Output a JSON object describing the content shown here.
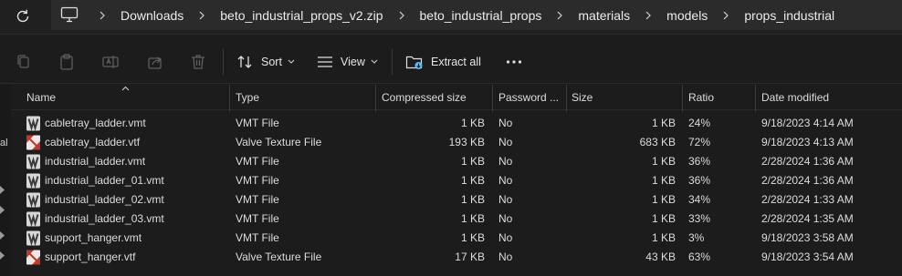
{
  "breadcrumbs": [
    "Downloads",
    "beto_industrial_props_v2.zip",
    "beto_industrial_props",
    "materials",
    "models",
    "props_industrial"
  ],
  "toolbar": {
    "sort_label": "Sort",
    "view_label": "View",
    "extract_label": "Extract all"
  },
  "left_pane_fragment": "al",
  "columns": {
    "name": "Name",
    "type": "Type",
    "compressed_size": "Compressed size",
    "password": "Password ...",
    "size": "Size",
    "ratio": "Ratio",
    "date_modified": "Date modified"
  },
  "files": [
    {
      "name": "cabletray_ladder.vmt",
      "icon": "vmt-file-icon",
      "type": "VMT File",
      "compressed": "1 KB",
      "password": "No",
      "size": "1 KB",
      "ratio": "24%",
      "date": "9/18/2023 4:14 AM"
    },
    {
      "name": "cabletray_ladder.vtf",
      "icon": "vtf-file-icon",
      "type": "Valve Texture File",
      "compressed": "193 KB",
      "password": "No",
      "size": "683 KB",
      "ratio": "72%",
      "date": "9/18/2023 4:13 AM"
    },
    {
      "name": "industrial_ladder.vmt",
      "icon": "vmt-file-icon",
      "type": "VMT File",
      "compressed": "1 KB",
      "password": "No",
      "size": "1 KB",
      "ratio": "36%",
      "date": "2/28/2024 1:36 AM"
    },
    {
      "name": "industrial_ladder_01.vmt",
      "icon": "vmt-file-icon",
      "type": "VMT File",
      "compressed": "1 KB",
      "password": "No",
      "size": "1 KB",
      "ratio": "36%",
      "date": "2/28/2024 1:36 AM"
    },
    {
      "name": "industrial_ladder_02.vmt",
      "icon": "vmt-file-icon",
      "type": "VMT File",
      "compressed": "1 KB",
      "password": "No",
      "size": "1 KB",
      "ratio": "34%",
      "date": "2/28/2024 1:33 AM"
    },
    {
      "name": "industrial_ladder_03.vmt",
      "icon": "vmt-file-icon",
      "type": "VMT File",
      "compressed": "1 KB",
      "password": "No",
      "size": "1 KB",
      "ratio": "33%",
      "date": "2/28/2024 1:35 AM"
    },
    {
      "name": "support_hanger.vmt",
      "icon": "vmt-file-icon",
      "type": "VMT File",
      "compressed": "1 KB",
      "password": "No",
      "size": "1 KB",
      "ratio": "3%",
      "date": "9/18/2023 3:58 AM"
    },
    {
      "name": "support_hanger.vtf",
      "icon": "vtf-file-icon",
      "type": "Valve Texture File",
      "compressed": "17 KB",
      "password": "No",
      "size": "43 KB",
      "ratio": "63%",
      "date": "9/18/2023 3:54 AM"
    }
  ],
  "colors": {
    "background": "#1c1c1c",
    "address_bar": "#2b2b2b",
    "text": "#e6e6e6",
    "accent": "#4cc2ff",
    "vtf_icon": "#c0392b"
  }
}
